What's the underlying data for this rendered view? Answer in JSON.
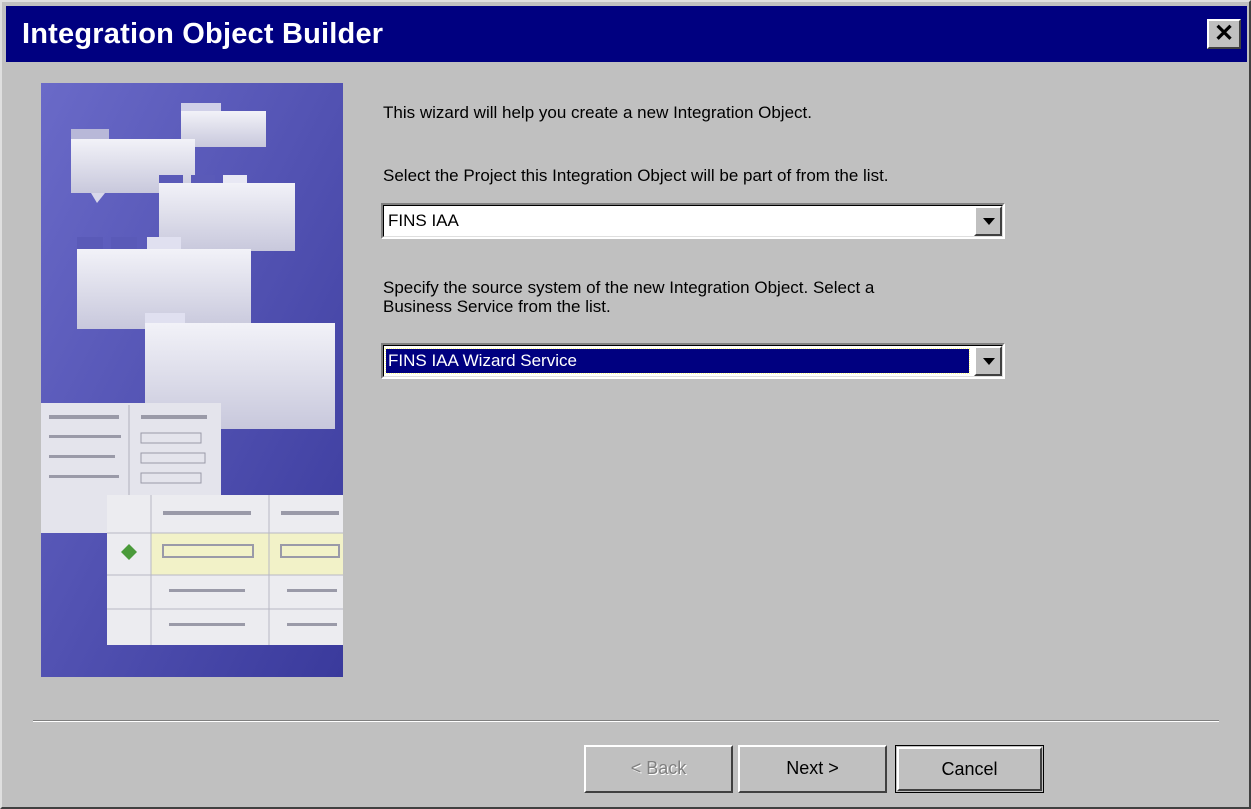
{
  "window": {
    "title": "Integration Object Builder",
    "close_glyph": "✕"
  },
  "wizard": {
    "intro": "This wizard will help you create a new Integration Object.",
    "project_prompt": "Select the Project this Integration Object will be part of from the list.",
    "project_value": "FINS IAA",
    "source_prompt_line1": "Specify the source system of the new Integration Object. Select a",
    "source_prompt_line2": "Business Service from the list.",
    "source_value": "FINS IAA Wizard Service"
  },
  "buttons": {
    "back": "< Back",
    "next": "Next >",
    "cancel": "Cancel"
  },
  "icons": {
    "close": "close-icon",
    "dropdown": "chevron-down-icon",
    "illustration": "folders-and-forms-illustration"
  },
  "colors": {
    "title_bar": "#000080",
    "dialog_bg": "#c0c0c0",
    "selection": "#000080"
  }
}
